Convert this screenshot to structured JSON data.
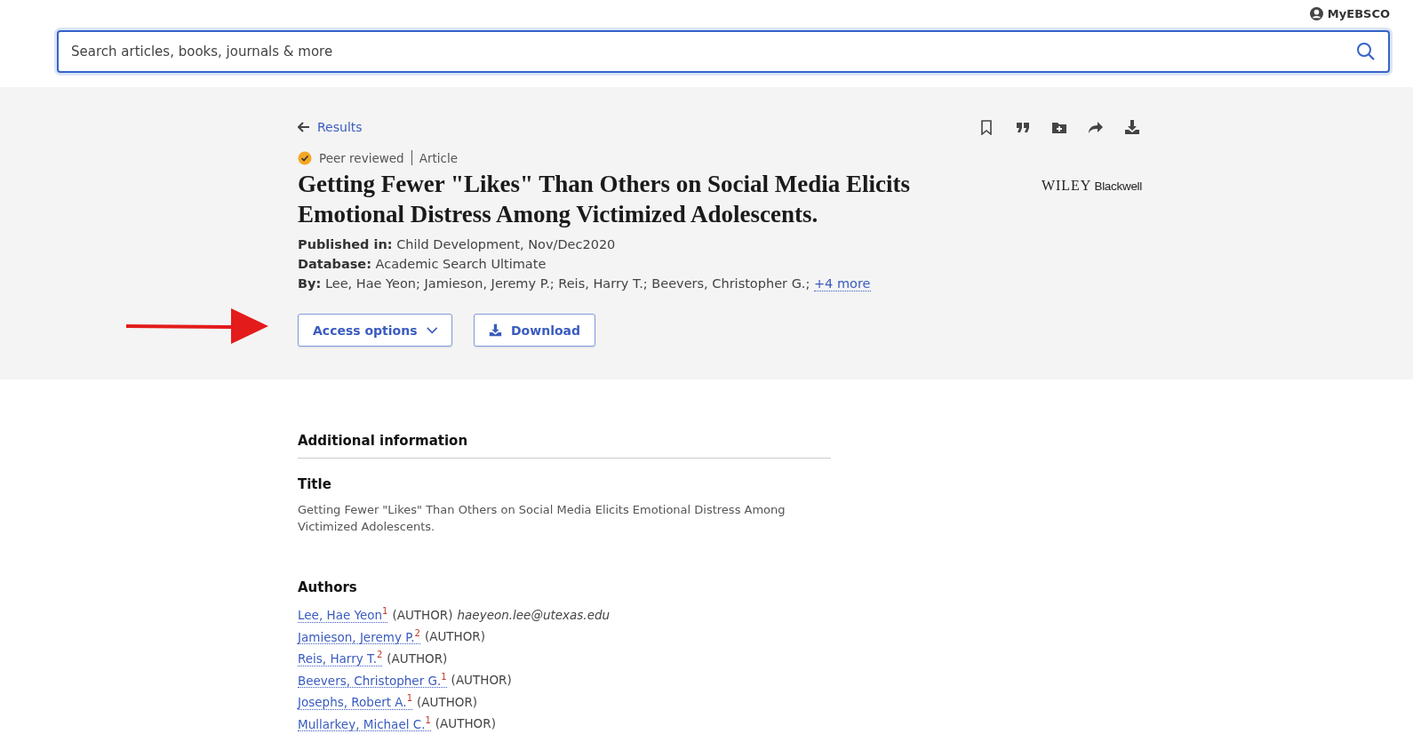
{
  "header": {
    "account_link": "MyEBSCO",
    "search": {
      "placeholder": "Search articles, books, journals & more"
    }
  },
  "record": {
    "back_link": "Results",
    "toolbar": [
      {
        "kind": "bookmark"
      },
      {
        "kind": "cite"
      },
      {
        "kind": "add-to-folder"
      },
      {
        "kind": "share"
      },
      {
        "kind": "download"
      }
    ],
    "badge": "Peer reviewed",
    "type": "Article",
    "title": "Getting Fewer \"Likes\" Than Others on Social Media Elicits Emotional Distress Among Victimized Adolescents.",
    "publisher_logo": [
      "WILEY",
      "Blackwell"
    ],
    "meta": [
      {
        "label": "Published in:",
        "value": "Child Development, Nov/Dec2020"
      },
      {
        "label": "Database:",
        "value": "Academic Search Ultimate"
      },
      {
        "label": "By:",
        "value": "Lee, Hae Yeon; Jamieson, Jeremy P.; Reis, Harry T.; Beevers, Christopher G.;",
        "link": "+4 more"
      }
    ],
    "buttons": [
      {
        "kind": "dropdown",
        "label": "Access options"
      },
      {
        "kind": "download",
        "label": "Download"
      }
    ]
  },
  "additional_information": {
    "heading": "Additional information",
    "title_heading": "Title",
    "title_text": "Getting Fewer \"Likes\" Than Others on Social Media Elicits Emotional Distress Among Victimized Adolescents.",
    "authors_heading": "Authors",
    "authors": [
      {
        "name": "Lee, Hae Yeon$^{1}$",
        "role": "(AUTHOR)",
        "email": "haeyeon.lee@utexas.edu"
      },
      {
        "name": "Jamieson, Jeremy P.$^{2}$",
        "role": "(AUTHOR)"
      },
      {
        "name": "Reis, Harry T.$^{2}$",
        "role": "(AUTHOR)"
      },
      {
        "name": "Beevers, Christopher G.$^{1}$",
        "role": "(AUTHOR)"
      },
      {
        "name": "Josephs, Robert A.$^{1}$",
        "role": "(AUTHOR)"
      },
      {
        "name": "Mullarkey, Michael C.$^{1}$",
        "role": "(AUTHOR)"
      }
    ]
  }
}
